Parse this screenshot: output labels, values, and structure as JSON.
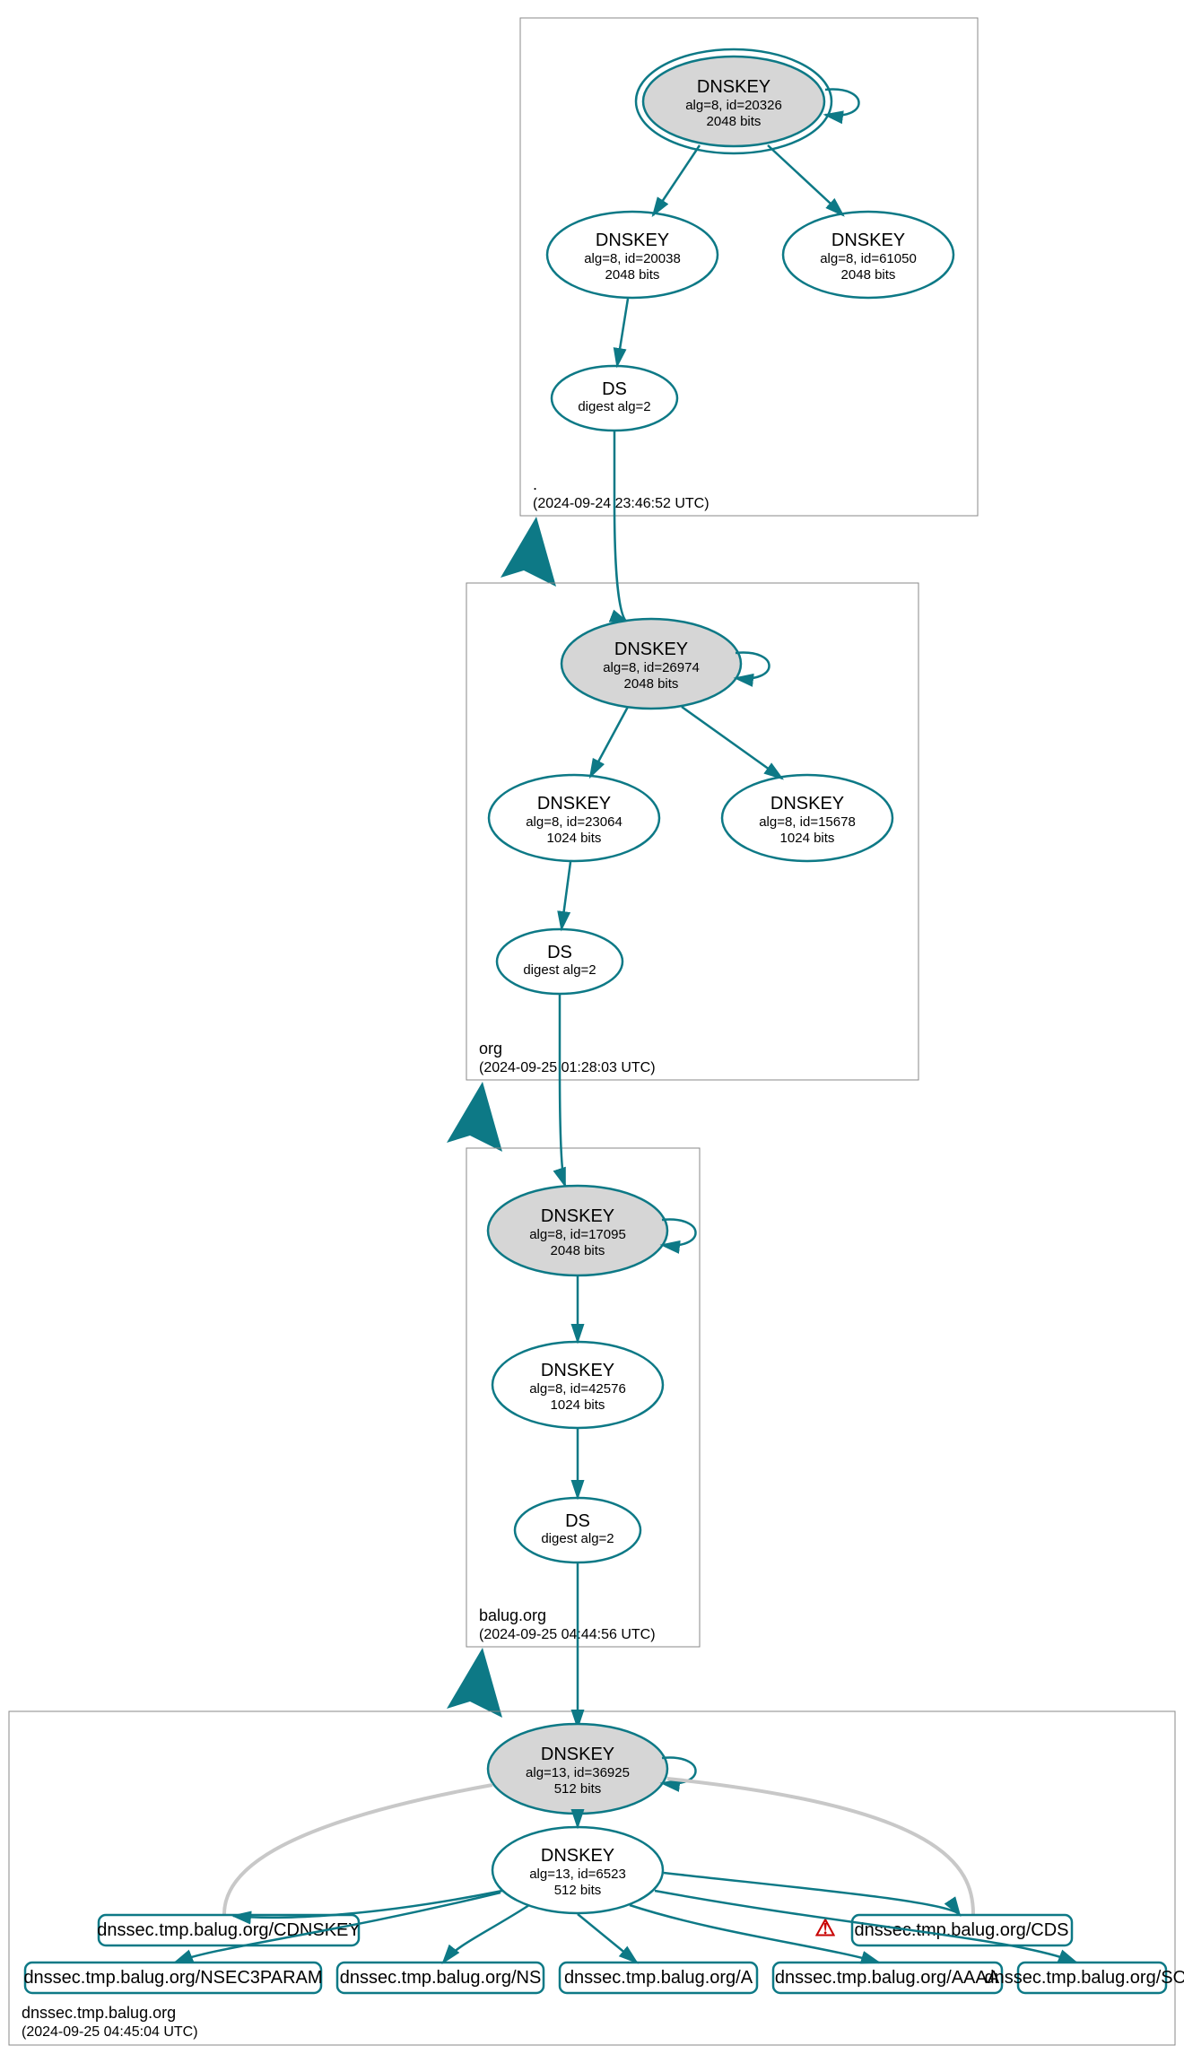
{
  "zones": {
    "root": {
      "label": ".",
      "ts": "(2024-09-24 23:46:52 UTC)"
    },
    "org": {
      "label": "org",
      "ts": "(2024-09-25 01:28:03 UTC)"
    },
    "balug": {
      "label": "balug.org",
      "ts": "(2024-09-25 04:44:56 UTC)"
    },
    "dnssec": {
      "label": "dnssec.tmp.balug.org",
      "ts": "(2024-09-25 04:45:04 UTC)"
    }
  },
  "nodes": {
    "root_ksk": {
      "t": "DNSKEY",
      "l1": "alg=8, id=20326",
      "l2": "2048 bits"
    },
    "root_zsk1": {
      "t": "DNSKEY",
      "l1": "alg=8, id=20038",
      "l2": "2048 bits"
    },
    "root_zsk2": {
      "t": "DNSKEY",
      "l1": "alg=8, id=61050",
      "l2": "2048 bits"
    },
    "root_ds": {
      "t": "DS",
      "l1": "digest alg=2",
      "l2": ""
    },
    "org_ksk": {
      "t": "DNSKEY",
      "l1": "alg=8, id=26974",
      "l2": "2048 bits"
    },
    "org_zsk1": {
      "t": "DNSKEY",
      "l1": "alg=8, id=23064",
      "l2": "1024 bits"
    },
    "org_zsk2": {
      "t": "DNSKEY",
      "l1": "alg=8, id=15678",
      "l2": "1024 bits"
    },
    "org_ds": {
      "t": "DS",
      "l1": "digest alg=2",
      "l2": ""
    },
    "bal_ksk": {
      "t": "DNSKEY",
      "l1": "alg=8, id=17095",
      "l2": "2048 bits"
    },
    "bal_zsk": {
      "t": "DNSKEY",
      "l1": "alg=8, id=42576",
      "l2": "1024 bits"
    },
    "bal_ds": {
      "t": "DS",
      "l1": "digest alg=2",
      "l2": ""
    },
    "dns_ksk": {
      "t": "DNSKEY",
      "l1": "alg=13, id=36925",
      "l2": "512 bits"
    },
    "dns_zsk": {
      "t": "DNSKEY",
      "l1": "alg=13, id=6523",
      "l2": "512 bits"
    }
  },
  "rr": {
    "cdn": "dnssec.tmp.balug.org/CDNSKEY",
    "cds": "dnssec.tmp.balug.org/CDS",
    "n3p": "dnssec.tmp.balug.org/NSEC3PARAM",
    "ns": "dnssec.tmp.balug.org/NS",
    "a": "dnssec.tmp.balug.org/A",
    "aaaa": "dnssec.tmp.balug.org/AAAA",
    "soa": "dnssec.tmp.balug.org/SOA"
  },
  "warn": "⚠"
}
